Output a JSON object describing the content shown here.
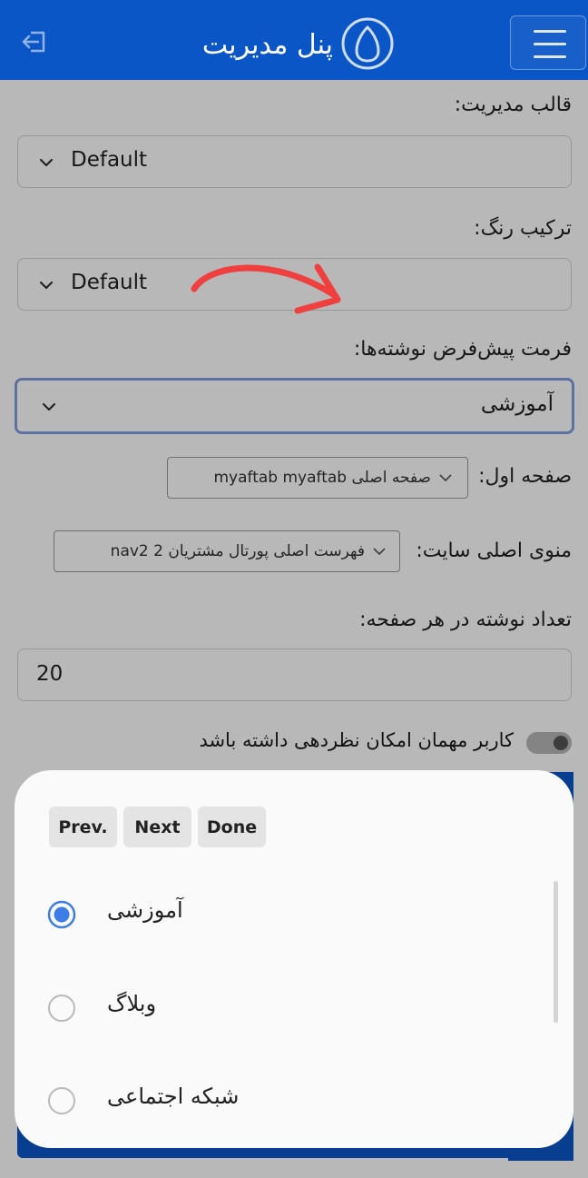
{
  "header": {
    "title": "پنل مدیریت",
    "background_color": "#0a56c7",
    "logout_icon": "logout-icon",
    "menu_icon": "hamburger-menu-icon"
  },
  "form": {
    "admin_theme": {
      "label": "قالب مدیریت:",
      "value": "Default"
    },
    "color_scheme": {
      "label": "ترکیب رنگ:",
      "value": "Default"
    },
    "post_format": {
      "label": "فرمت پیش‌فرض نوشته‌ها:",
      "value": "آموزشی"
    },
    "home_page": {
      "label": "صفحه اول:",
      "value": "صفحه اصلی myaftab myaftab"
    },
    "main_menu": {
      "label": "منوی اصلی سایت:",
      "value": "فهرست اصلی پورتال مشتریان 2 nav2"
    },
    "posts_per_page": {
      "label": "تعداد نوشته در هر صفحه:",
      "value": "20"
    },
    "guest_comments": {
      "label": "کاربر مهمان امکان نظردهی داشته باشد",
      "checked": false
    }
  },
  "picker": {
    "prev_label": "Prev.",
    "next_label": "Next",
    "done_label": "Done",
    "options": [
      {
        "label": "آموزشی",
        "selected": true
      },
      {
        "label": "وبلاگ",
        "selected": false
      },
      {
        "label": "شبکه اجتماعی",
        "selected": false
      }
    ],
    "accent_color": "#3d7de6"
  }
}
